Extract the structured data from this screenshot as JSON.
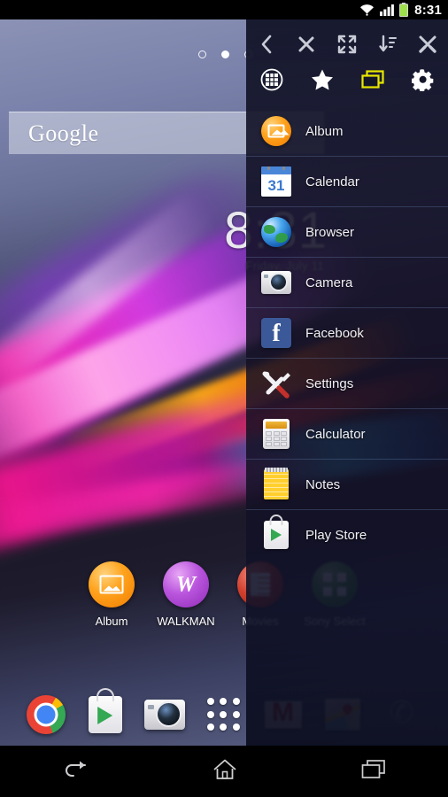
{
  "status_bar": {
    "time": "8:31",
    "icons": [
      "wifi-icon",
      "cellular-signal-icon",
      "battery-icon"
    ]
  },
  "home_screen": {
    "page_indicator": {
      "total": 3,
      "active_index": 1
    },
    "search_widget": {
      "label": "Google",
      "mic_icon": "microphone-icon"
    },
    "clock_widget": {
      "time": "8:31",
      "date": "Friday, July 11"
    },
    "app_row": [
      {
        "label": "Album",
        "icon": "album-icon"
      },
      {
        "label": "WALKMAN",
        "icon": "walkman-icon"
      },
      {
        "label": "Movies",
        "icon": "movies-icon"
      },
      {
        "label": "Sony Select",
        "icon": "sony-select-icon"
      }
    ],
    "dock": [
      {
        "label": "Chrome",
        "icon": "chrome-icon"
      },
      {
        "label": "Play Store",
        "icon": "play-store-icon"
      },
      {
        "label": "Camera",
        "icon": "camera-icon"
      },
      {
        "label": "Apps",
        "icon": "app-drawer-icon"
      },
      {
        "label": "Gmail",
        "icon": "gmail-icon"
      },
      {
        "label": "Maps",
        "icon": "maps-icon"
      },
      {
        "label": "Phone",
        "icon": "phone-icon"
      }
    ]
  },
  "panel": {
    "toolbar_row_1": [
      {
        "name": "back",
        "icon": "chevron-left-icon"
      },
      {
        "name": "close",
        "icon": "close-x-icon"
      },
      {
        "name": "collapse",
        "icon": "collapse-arrows-icon"
      },
      {
        "name": "sort",
        "icon": "sort-descending-icon"
      },
      {
        "name": "tools",
        "icon": "tools-icon"
      }
    ],
    "toolbar_row_2": [
      {
        "name": "apps",
        "icon": "grid-circle-icon",
        "selected": false
      },
      {
        "name": "favorites",
        "icon": "star-icon",
        "selected": false
      },
      {
        "name": "windows",
        "icon": "windows-icon",
        "selected": true
      },
      {
        "name": "settings",
        "icon": "gear-icon",
        "selected": false
      }
    ],
    "accent_color": "#e8e800",
    "apps": [
      {
        "label": "Album",
        "icon": "album-icon"
      },
      {
        "label": "Calendar",
        "icon": "calendar-icon",
        "badge": "31"
      },
      {
        "label": "Browser",
        "icon": "browser-globe-icon"
      },
      {
        "label": "Camera",
        "icon": "camera-icon"
      },
      {
        "label": "Facebook",
        "icon": "facebook-icon",
        "badge": "f"
      },
      {
        "label": "Settings",
        "icon": "settings-tools-icon"
      },
      {
        "label": "Calculator",
        "icon": "calculator-icon"
      },
      {
        "label": "Notes",
        "icon": "notes-icon"
      },
      {
        "label": "Play Store",
        "icon": "play-store-icon"
      }
    ]
  },
  "nav_bar": [
    {
      "name": "back",
      "icon": "back-arrow-icon"
    },
    {
      "name": "home",
      "icon": "home-icon"
    },
    {
      "name": "recents",
      "icon": "recents-icon"
    }
  ]
}
